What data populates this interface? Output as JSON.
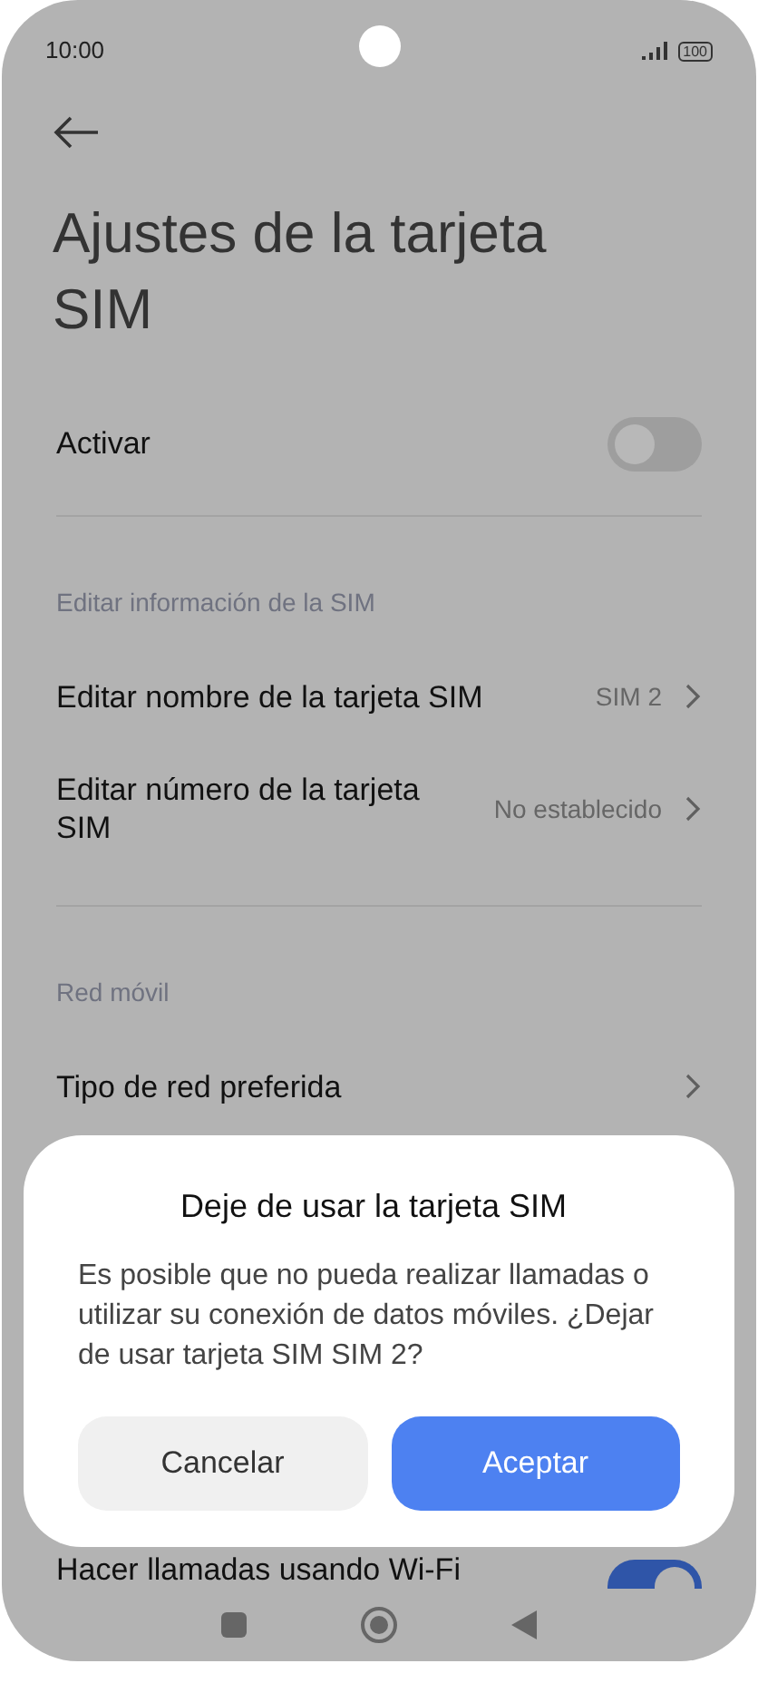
{
  "status_bar": {
    "time": "10:00",
    "battery": "100"
  },
  "title": "Ajustes de la tarjeta SIM",
  "activate": {
    "label": "Activar",
    "on": false
  },
  "sections": [
    {
      "header": "Editar información de la SIM",
      "rows": [
        {
          "label": "Editar nombre de la tarjeta SIM",
          "value": "SIM 2"
        },
        {
          "label": "Editar número de la tarjeta SIM",
          "value": "No establecido"
        }
      ]
    },
    {
      "header": "Red móvil",
      "rows": [
        {
          "label": "Tipo de red preferida"
        }
      ]
    }
  ],
  "wifi_calling": {
    "label": "Hacer llamadas usando Wi-Fi",
    "on": true
  },
  "dialog": {
    "title": "Deje de usar la tarjeta SIM",
    "message": "Es posible que no pueda realizar llamadas o utilizar su conexión de datos móviles. ¿Dejar de usar tarjeta SIM SIM 2?",
    "buttons": [
      {
        "label": "Cancelar",
        "kind": "secondary"
      },
      {
        "label": "Aceptar",
        "kind": "primary"
      }
    ]
  }
}
